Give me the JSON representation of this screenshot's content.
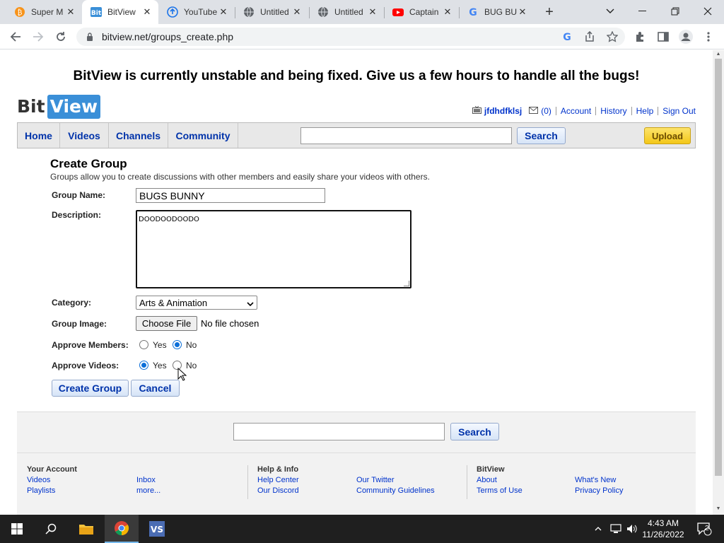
{
  "browser": {
    "tabs": [
      {
        "title": "Super M",
        "favicon": "bitcoin-icon"
      },
      {
        "title": "BitView",
        "favicon": "bitview-icon",
        "active": true
      },
      {
        "title": "YouTube",
        "favicon": "upload-icon"
      },
      {
        "title": "Untitled",
        "favicon": "globe-icon"
      },
      {
        "title": "Untitled",
        "favicon": "globe-icon"
      },
      {
        "title": "Captain",
        "favicon": "youtube-icon"
      },
      {
        "title": "BUG BU",
        "favicon": "google-icon"
      }
    ],
    "url": "bitview.net/groups_create.php"
  },
  "page": {
    "banner": "BitView is currently unstable and being fixed. Give us a few hours to handle all the bugs!",
    "logo": {
      "bit": "Bit",
      "view": "View"
    },
    "userbar": {
      "username": "jfdhdfklsj",
      "inbox_count": "(0)",
      "links": [
        "Account",
        "History",
        "Help",
        "Sign Out"
      ]
    },
    "nav": {
      "items": [
        "Home",
        "Videos",
        "Channels",
        "Community"
      ],
      "search_button": "Search",
      "upload_button": "Upload"
    },
    "form": {
      "title": "Create Group",
      "subtitle": "Groups allow you to create discussions with other members and easily share your videos with others.",
      "group_name_label": "Group Name:",
      "group_name_value": "BUGS BUNNY",
      "description_label": "Description:",
      "description_value": "DOODOODOODO",
      "category_label": "Category:",
      "category_value": "Arts & Animation",
      "image_label": "Group Image:",
      "choose_file": "Choose File",
      "no_file": "No file chosen",
      "approve_members_label": "Approve Members:",
      "approve_members_value": "No",
      "approve_videos_label": "Approve Videos:",
      "approve_videos_value": "Yes",
      "yes": "Yes",
      "no": "No",
      "create_button": "Create Group",
      "cancel_button": "Cancel"
    },
    "footer": {
      "search_button": "Search",
      "col1_heading": "Your Account",
      "col1_links": [
        "Videos",
        "Playlists",
        "Inbox",
        "more..."
      ],
      "col2_heading": "Help & Info",
      "col2_links": [
        "Help Center",
        "Our Discord",
        "Our Twitter",
        "Community Guidelines"
      ],
      "col3_heading": "BitView",
      "col3_links": [
        "About",
        "Terms of Use",
        "What's New",
        "Privacy Policy"
      ]
    }
  },
  "taskbar": {
    "time": "4:43 AM",
    "date": "11/26/2022",
    "notifications": "2"
  }
}
